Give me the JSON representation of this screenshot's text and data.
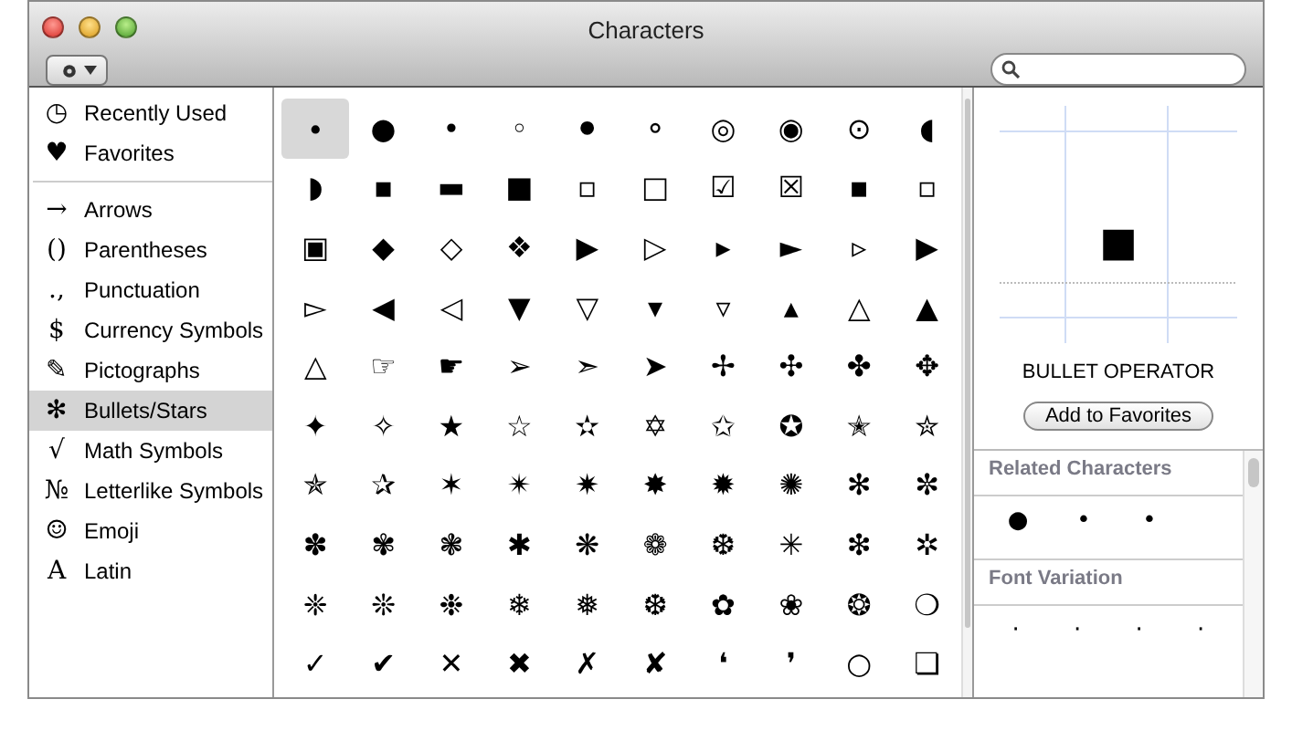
{
  "window": {
    "title": "Characters"
  },
  "sidebar": {
    "groups": [
      {
        "items": [
          {
            "glyph": "◷",
            "label": "Recently Used",
            "selected": false
          },
          {
            "glyph": "♥",
            "label": "Favorites",
            "selected": false
          }
        ]
      },
      {
        "items": [
          {
            "glyph": "→",
            "label": "Arrows",
            "selected": false
          },
          {
            "glyph": "()",
            "label": "Parentheses",
            "selected": false
          },
          {
            "glyph": ".,",
            "label": "Punctuation",
            "selected": false
          },
          {
            "glyph": "$",
            "label": "Currency Symbols",
            "selected": false
          },
          {
            "glyph": "✎",
            "label": "Pictographs",
            "selected": false
          },
          {
            "glyph": "✻",
            "label": "Bullets/Stars",
            "selected": true
          },
          {
            "glyph": "√",
            "label": "Math Symbols",
            "selected": false
          },
          {
            "glyph": "№",
            "label": "Letterlike Symbols",
            "selected": false
          },
          {
            "glyph": "☺",
            "label": "Emoji",
            "selected": false
          },
          {
            "glyph": "A",
            "label": "Latin",
            "selected": false
          }
        ]
      }
    ]
  },
  "characters": [
    {
      "char": "∙",
      "selected": true
    },
    {
      "char": "●",
      "selected": false
    },
    {
      "char": "•",
      "selected": false
    },
    {
      "char": "◦",
      "selected": false
    },
    {
      "char": "⚫",
      "selected": false
    },
    {
      "char": "⚬",
      "selected": false
    },
    {
      "char": "◎",
      "selected": false
    },
    {
      "char": "◉",
      "selected": false
    },
    {
      "char": "⊙",
      "selected": false
    },
    {
      "char": "◖",
      "selected": false
    },
    {
      "char": "◗",
      "selected": false
    },
    {
      "char": "▪",
      "selected": false
    },
    {
      "char": "▬",
      "selected": false
    },
    {
      "char": "■",
      "selected": false
    },
    {
      "char": "▫",
      "selected": false
    },
    {
      "char": "□",
      "selected": false
    },
    {
      "char": "☑",
      "selected": false
    },
    {
      "char": "☒",
      "selected": false
    },
    {
      "char": "▪",
      "selected": false
    },
    {
      "char": "▫",
      "selected": false
    },
    {
      "char": "▣",
      "selected": false
    },
    {
      "char": "◆",
      "selected": false
    },
    {
      "char": "◇",
      "selected": false
    },
    {
      "char": "❖",
      "selected": false
    },
    {
      "char": "▶",
      "selected": false
    },
    {
      "char": "▷",
      "selected": false
    },
    {
      "char": "▸",
      "selected": false
    },
    {
      "char": "►",
      "selected": false
    },
    {
      "char": "▹",
      "selected": false
    },
    {
      "char": "▶",
      "selected": false
    },
    {
      "char": "▻",
      "selected": false
    },
    {
      "char": "◀",
      "selected": false
    },
    {
      "char": "◁",
      "selected": false
    },
    {
      "char": "▼",
      "selected": false
    },
    {
      "char": "▽",
      "selected": false
    },
    {
      "char": "▾",
      "selected": false
    },
    {
      "char": "▿",
      "selected": false
    },
    {
      "char": "▴",
      "selected": false
    },
    {
      "char": "△",
      "selected": false
    },
    {
      "char": "▲",
      "selected": false
    },
    {
      "char": "△",
      "selected": false
    },
    {
      "char": "☞",
      "selected": false
    },
    {
      "char": "☛",
      "selected": false
    },
    {
      "char": "➢",
      "selected": false
    },
    {
      "char": "➣",
      "selected": false
    },
    {
      "char": "➤",
      "selected": false
    },
    {
      "char": "✢",
      "selected": false
    },
    {
      "char": "✣",
      "selected": false
    },
    {
      "char": "✤",
      "selected": false
    },
    {
      "char": "✥",
      "selected": false
    },
    {
      "char": "✦",
      "selected": false
    },
    {
      "char": "✧",
      "selected": false
    },
    {
      "char": "★",
      "selected": false
    },
    {
      "char": "☆",
      "selected": false
    },
    {
      "char": "✫",
      "selected": false
    },
    {
      "char": "✡",
      "selected": false
    },
    {
      "char": "✩",
      "selected": false
    },
    {
      "char": "✪",
      "selected": false
    },
    {
      "char": "✭",
      "selected": false
    },
    {
      "char": "✮",
      "selected": false
    },
    {
      "char": "✯",
      "selected": false
    },
    {
      "char": "✰",
      "selected": false
    },
    {
      "char": "✶",
      "selected": false
    },
    {
      "char": "✴",
      "selected": false
    },
    {
      "char": "✷",
      "selected": false
    },
    {
      "char": "✸",
      "selected": false
    },
    {
      "char": "✹",
      "selected": false
    },
    {
      "char": "✺",
      "selected": false
    },
    {
      "char": "✻",
      "selected": false
    },
    {
      "char": "✼",
      "selected": false
    },
    {
      "char": "✽",
      "selected": false
    },
    {
      "char": "✾",
      "selected": false
    },
    {
      "char": "❃",
      "selected": false
    },
    {
      "char": "✱",
      "selected": false
    },
    {
      "char": "❋",
      "selected": false
    },
    {
      "char": "❁",
      "selected": false
    },
    {
      "char": "❆",
      "selected": false
    },
    {
      "char": "✳",
      "selected": false
    },
    {
      "char": "❇",
      "selected": false
    },
    {
      "char": "✲",
      "selected": false
    },
    {
      "char": "❈",
      "selected": false
    },
    {
      "char": "❊",
      "selected": false
    },
    {
      "char": "❉",
      "selected": false
    },
    {
      "char": "❄",
      "selected": false
    },
    {
      "char": "❅",
      "selected": false
    },
    {
      "char": "❆",
      "selected": false
    },
    {
      "char": "✿",
      "selected": false
    },
    {
      "char": "❀",
      "selected": false
    },
    {
      "char": "❂",
      "selected": false
    },
    {
      "char": "❍",
      "selected": false
    },
    {
      "char": "✓",
      "selected": false
    },
    {
      "char": "✔",
      "selected": false
    },
    {
      "char": "✕",
      "selected": false
    },
    {
      "char": "✖",
      "selected": false
    },
    {
      "char": "✗",
      "selected": false
    },
    {
      "char": "✘",
      "selected": false
    },
    {
      "char": "❛",
      "selected": false
    },
    {
      "char": "❜",
      "selected": false
    },
    {
      "char": "○",
      "selected": false
    },
    {
      "char": "❏",
      "selected": false
    }
  ],
  "preview": {
    "char": "■",
    "name": "BULLET OPERATOR",
    "button": "Add to Favorites"
  },
  "sections": [
    {
      "title": "Related Characters",
      "chars": [
        "●",
        "•",
        "•"
      ]
    },
    {
      "title": "Font Variation",
      "chars": [
        "·",
        "·",
        "·",
        "·"
      ]
    }
  ]
}
